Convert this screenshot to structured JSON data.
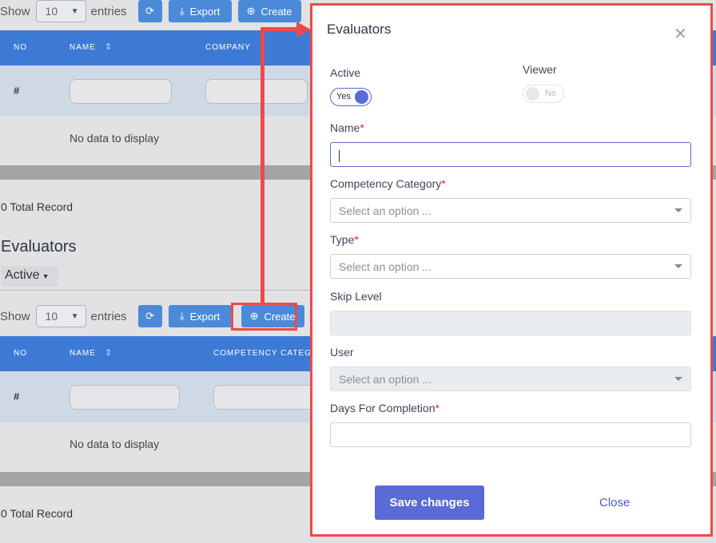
{
  "table1": {
    "show_label": "Show",
    "entries_value": "10",
    "entries_label": "entries",
    "export_label": "Export",
    "create_label": "Create",
    "headers": [
      "NO",
      "NAME",
      "COMPANY"
    ],
    "filter_hash": "#",
    "empty_text": "No data to display",
    "total_text": "0 Total Record"
  },
  "section": {
    "title": "Evaluators",
    "status_dropdown": "Active"
  },
  "table2": {
    "show_label": "Show",
    "entries_value": "10",
    "entries_label": "entries",
    "export_label": "Export",
    "create_label": "Create",
    "headers": [
      "NO",
      "NAME",
      "COMPETENCY CATEGO"
    ],
    "filter_hash": "#",
    "empty_text": "No data to display",
    "total_text": "0 Total Record"
  },
  "modal": {
    "title": "Evaluators",
    "active_label": "Active",
    "active_toggle": "Yes",
    "viewer_label": "Viewer",
    "viewer_toggle": "No",
    "name_label": "Name",
    "competency_label": "Competency Category",
    "competency_placeholder": "Select an option ...",
    "type_label": "Type",
    "type_placeholder": "Select an option ...",
    "skip_level_label": "Skip Level",
    "user_label": "User",
    "user_placeholder": "Select an option ...",
    "days_label": "Days For Completion",
    "required_mark": "*",
    "save_label": "Save changes",
    "close_label": "Close"
  },
  "colors": {
    "accent": "#5a6ad6",
    "table_header": "#3d7ad6",
    "highlight": "#ee4a4a"
  },
  "icons": [
    "refresh-icon",
    "download-icon",
    "plus-circle-icon",
    "close-icon",
    "chevron-down-icon",
    "sort-icon"
  ]
}
